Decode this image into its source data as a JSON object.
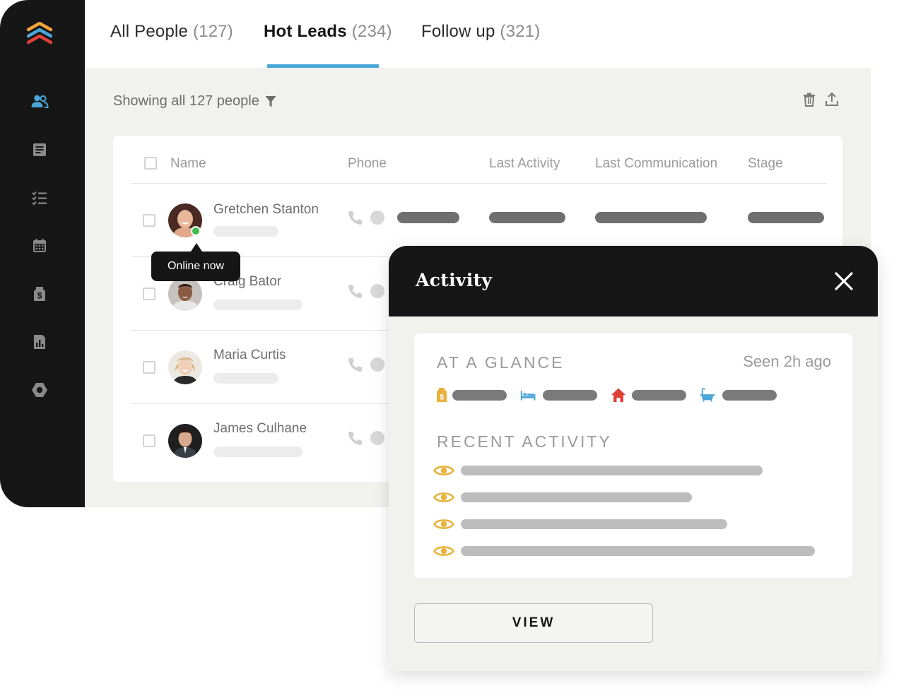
{
  "tabs": [
    {
      "label": "All People",
      "count": "(127)"
    },
    {
      "label": "Hot Leads",
      "count": "(234)"
    },
    {
      "label": "Follow up",
      "count": "(321)"
    }
  ],
  "active_tab": "Hot Leads",
  "showing_text": "Showing all 127 people",
  "table": {
    "columns": [
      "Name",
      "Phone",
      "Last Activity",
      "Last Communication",
      "Stage"
    ],
    "rows": [
      {
        "name": "Gretchen Stanton",
        "online": true
      },
      {
        "name": "Craig Bator",
        "online": false
      },
      {
        "name": "Maria Curtis",
        "online": false
      },
      {
        "name": "James Culhane",
        "online": false
      }
    ]
  },
  "tooltip": "Online now",
  "activity_panel": {
    "title": "Activity",
    "at_a_glance": "AT A GLANCE",
    "seen": "Seen 2h ago",
    "recent_activity": "RECENT ACTIVITY",
    "view_button": "VIEW"
  },
  "icons": {
    "sidebar": [
      "people-icon",
      "notes-icon",
      "tasks-icon",
      "calendar-icon",
      "deals-icon",
      "reports-icon",
      "settings-icon"
    ],
    "toolbar": [
      "trash-icon",
      "export-icon"
    ],
    "glance": [
      "price-tag-icon",
      "bed-icon",
      "house-icon",
      "bath-icon"
    ],
    "activity": [
      "eye-icon"
    ]
  },
  "colors": {
    "sidebar_bg": "#161616",
    "accent_blue": "#4aa5d8",
    "online_green": "#3dbb4f",
    "eye_gold": "#e8b23c",
    "house_red": "#e0403a"
  }
}
